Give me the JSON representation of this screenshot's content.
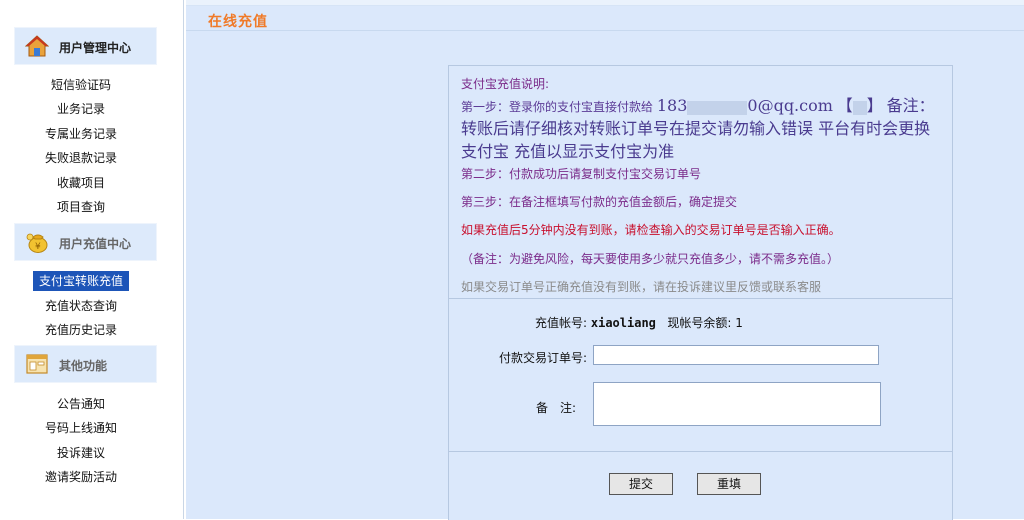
{
  "sidebar": {
    "sections": [
      {
        "title": "用户管理中心",
        "icon": "home-icon",
        "items": [
          "短信验证码",
          "业务记录",
          "专属业务记录",
          "失败退款记录",
          "收藏项目",
          "项目查询"
        ]
      },
      {
        "title": "用户充值中心",
        "icon": "money-bag-icon",
        "items": [
          "支付宝转账充值",
          "充值状态查询",
          "充值历史记录"
        ]
      },
      {
        "title": "其他功能",
        "icon": "window-icon",
        "items": [
          "公告通知",
          "号码上线通知",
          "投诉建议",
          "邀请奖励活动"
        ]
      }
    ],
    "active_item": "支付宝转账充值"
  },
  "main": {
    "title": "在线充值",
    "instructions": {
      "heading": "支付宝充值说明:",
      "step1_prefix": "第一步：登录你的支付宝直接付款给",
      "step1_account_start": "183",
      "step1_account_end": "0@qq.com",
      "step1_name_start": "【",
      "step1_name_end": "】",
      "step1_note": "备注：转账后请仔细核对转账订单号在提交请勿输入错误 平台有时会更换支付宝 充值以显示支付宝为准",
      "step2": "第二步：付款成功后请复制支付宝交易订单号",
      "step3": "第三步：在备注框填写付款的充值金额后，确定提交",
      "warning": "如果充值后5分钟内没有到账，请检查输入的交易订单号是否输入正确。",
      "remark": "（备注：为避免风险，每天要使用多少就只充值多少，请不需多充值。）",
      "contact": "如果交易订单号正确充值没有到账，请在投诉建议里反馈或联系客服"
    },
    "form": {
      "account_label": "充值帐号:",
      "account_value": "xiaoliang",
      "balance_label": "现帐号余额:",
      "balance_value": "1",
      "order_label": "付款交易订单号:",
      "order_value": "",
      "note_label": "备　注:",
      "note_value": ""
    },
    "buttons": {
      "submit": "提交",
      "reset": "重填"
    }
  },
  "colors": {
    "accent_title": "#f07a28",
    "sidebar_active": "#1d55b8",
    "main_bg": "#dbe8fb",
    "instruction_purple": "#7b2b8a",
    "warning_red": "#c8102e"
  }
}
